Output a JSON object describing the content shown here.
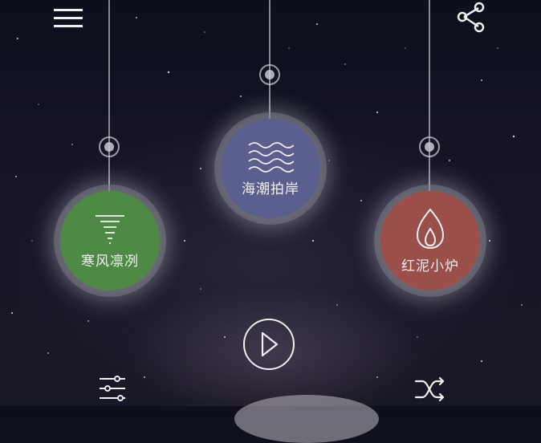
{
  "header": {
    "menu_icon": "hamburger-menu-icon",
    "share_icon": "share-icon"
  },
  "sounds": [
    {
      "label": "寒风凛冽",
      "icon": "wind-icon",
      "color": "#4e8a46"
    },
    {
      "label": "海潮拍岸",
      "icon": "waves-icon",
      "color": "#5b5f8e"
    },
    {
      "label": "红泥小炉",
      "icon": "flame-icon",
      "color": "#9a4f4b"
    }
  ],
  "controls": {
    "play_icon": "play-icon",
    "settings_icon": "sliders-icon",
    "shuffle_icon": "shuffle-icon"
  }
}
